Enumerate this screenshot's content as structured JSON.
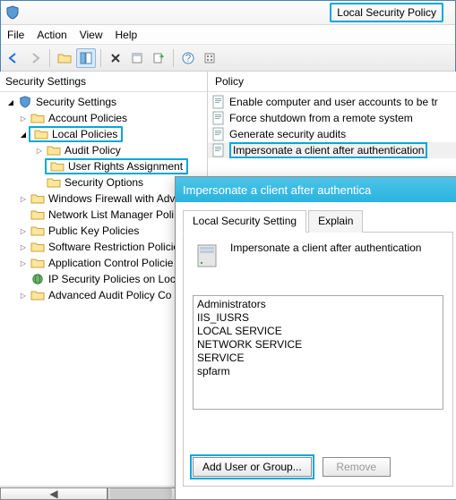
{
  "window": {
    "title": "Local Security Policy"
  },
  "menu": {
    "file": "File",
    "action": "Action",
    "view": "View",
    "help": "Help"
  },
  "tree": {
    "header": "Security Settings",
    "root": "Security Settings",
    "account_policies": "Account Policies",
    "local_policies": "Local Policies",
    "audit_policy": "Audit Policy",
    "user_rights": "User Rights Assignment",
    "security_options": "Security Options",
    "windows_firewall": "Windows Firewall with Adv",
    "network_list": "Network List Manager Poli",
    "public_key": "Public Key Policies",
    "software_restriction": "Software Restriction Policie",
    "app_control": "Application Control Policie",
    "ip_security": "IP Security Policies on Loca",
    "advanced_audit": "Advanced Audit Policy Co"
  },
  "list": {
    "header": "Policy",
    "items": [
      "Enable computer and user accounts to be tr",
      "Force shutdown from a remote system",
      "Generate security audits",
      "Impersonate a client after authentication"
    ]
  },
  "dialog": {
    "title": "Impersonate a client after authentica",
    "tab_setting": "Local Security Setting",
    "tab_explain": "Explain",
    "policy_label": "Impersonate a client after authentication",
    "principals": [
      "Administrators",
      "IIS_IUSRS",
      "LOCAL SERVICE",
      "NETWORK SERVICE",
      "SERVICE",
      "spfarm"
    ],
    "add_btn": "Add User or Group...",
    "remove_btn": "Remove"
  }
}
